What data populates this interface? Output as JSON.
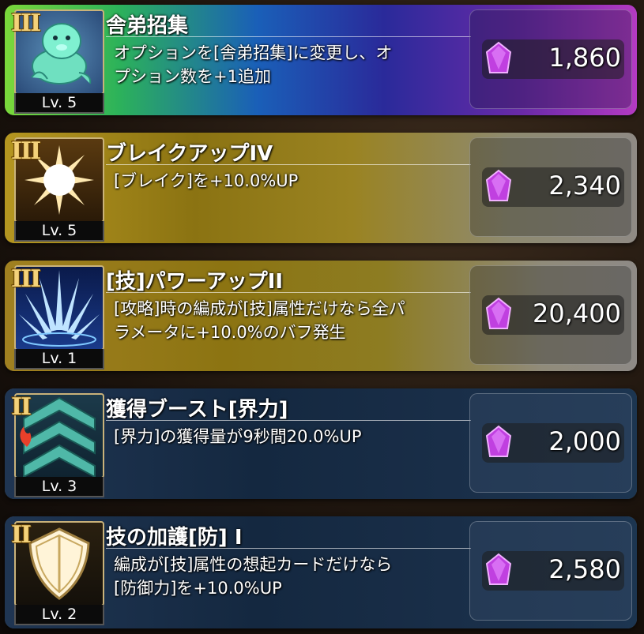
{
  "cards": [
    {
      "rank": "III",
      "title": "舎弟招集",
      "desc_line1": "オプションを[舎弟招集]に変更し、オ",
      "desc_line2": "プション数を+1追加",
      "level": "Lv. 5",
      "cost": "1,860",
      "icon": "seal-mascot-icon"
    },
    {
      "rank": "III",
      "title": "ブレイクアップIV",
      "desc_line1": "[ブレイク]を+10.0%UP",
      "desc_line2": "",
      "level": "Lv. 5",
      "cost": "2,340",
      "icon": "burst-icon"
    },
    {
      "rank": "III",
      "title": "[技]パワーアップII",
      "desc_line1": "[攻略]時の編成が[技]属性だけなら全パ",
      "desc_line2": "ラメータに+10.0%のバフ発生",
      "level": "Lv. 1",
      "cost": "20,400",
      "icon": "power-spikes-icon"
    },
    {
      "rank": "II",
      "title": "獲得ブースト[界力]",
      "desc_line1": "[界力]の獲得量が9秒間20.0%UP",
      "desc_line2": "",
      "level": "Lv. 3",
      "cost": "2,000",
      "icon": "chevron-boost-icon"
    },
    {
      "rank": "II",
      "title": "技の加護[防] I",
      "desc_line1": "編成が[技]属性の想起カードだけなら",
      "desc_line2": "[防御力]を+10.0%UP",
      "level": "Lv. 2",
      "cost": "2,580",
      "icon": "shield-icon"
    }
  ],
  "colors": {
    "gem": "#c040e0",
    "rank": "#f4d27a"
  }
}
